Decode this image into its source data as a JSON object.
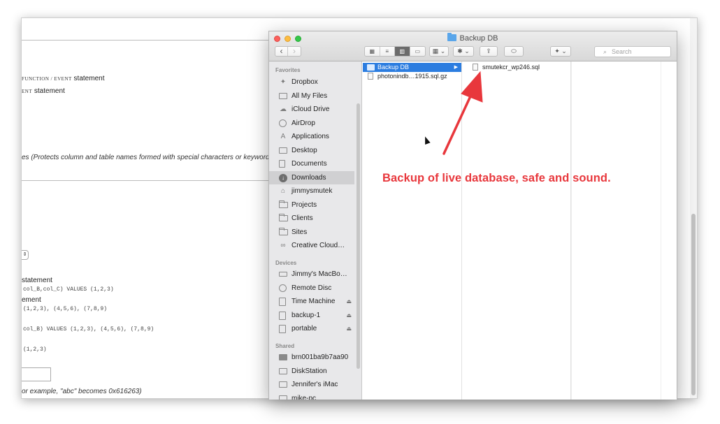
{
  "background_page": {
    "lines": [
      {
        "small_caps": "FUNCTION / EVENT",
        "text": " statement"
      },
      {
        "small_caps": "ENT",
        "text": " statement"
      }
    ],
    "protect_text": "es (Protects column and table names formed with special characters or keywords)",
    "select_glyph": "⇕",
    "statement_1": "statement",
    "code_1": "col_B,col_C) VALUES (1,2,3)",
    "statement_2": "ement",
    "code_2": "(1,2,3), (4,5,6), (7,8,9)",
    "code_3": "col_B) VALUES (1,2,3), (4,5,6), (7,8,9)",
    "code_4": "(1,2,3)",
    "example_text": "or example, \"abc\" becomes 0x616263)"
  },
  "finder": {
    "title": "Backup DB",
    "toolbar": {
      "back_label": "‹",
      "forward_label": "›",
      "view_icons": [
        "▦",
        "≡",
        "▥",
        "▭"
      ],
      "arrange_label": "▦ ⌄",
      "action_label": "✱ ⌄",
      "share_label": "⇪",
      "tag_label": "⬭",
      "dropbox_label": "✦ ⌄",
      "search_placeholder": "Search"
    },
    "sidebar": {
      "favorites_heading": "Favorites",
      "favorites": [
        {
          "label": "Dropbox",
          "icon": "dropbox-icon",
          "glyph": "✦"
        },
        {
          "label": "All My Files",
          "icon": "all-files-icon",
          "glyph": ""
        },
        {
          "label": "iCloud Drive",
          "icon": "cloud-icon",
          "glyph": "☁"
        },
        {
          "label": "AirDrop",
          "icon": "airdrop-icon",
          "glyph": ""
        },
        {
          "label": "Applications",
          "icon": "applications-icon",
          "glyph": "A"
        },
        {
          "label": "Desktop",
          "icon": "desktop-icon",
          "glyph": ""
        },
        {
          "label": "Documents",
          "icon": "documents-icon",
          "glyph": ""
        },
        {
          "label": "Downloads",
          "icon": "downloads-icon",
          "glyph": "↓"
        },
        {
          "label": "jimmysmutek",
          "icon": "home-icon",
          "glyph": "⌂"
        },
        {
          "label": "Projects",
          "icon": "folder-icon",
          "glyph": ""
        },
        {
          "label": "Clients",
          "icon": "folder-icon",
          "glyph": ""
        },
        {
          "label": "Sites",
          "icon": "folder-icon",
          "glyph": ""
        },
        {
          "label": "Creative Cloud…",
          "icon": "creative-cloud-icon",
          "glyph": "∞"
        }
      ],
      "devices_heading": "Devices",
      "devices": [
        {
          "label": "Jimmy's MacBo…",
          "icon": "laptop-icon",
          "eject": ""
        },
        {
          "label": "Remote Disc",
          "icon": "disc-icon",
          "eject": ""
        },
        {
          "label": "Time Machine",
          "icon": "drive-icon",
          "eject": "⏏"
        },
        {
          "label": "backup-1",
          "icon": "drive-icon",
          "eject": "⏏"
        },
        {
          "label": "portable",
          "icon": "drive-icon",
          "eject": "⏏"
        }
      ],
      "shared_heading": "Shared",
      "shared": [
        {
          "label": "brn001ba9b7aa90",
          "icon": "printer-icon"
        },
        {
          "label": "DiskStation",
          "icon": "display-icon"
        },
        {
          "label": "Jennifer's iMac",
          "icon": "display-icon"
        },
        {
          "label": "mike-pc",
          "icon": "display-icon"
        }
      ]
    },
    "column1": [
      {
        "label": "Backup DB",
        "type": "folder",
        "selected": true
      },
      {
        "label": "photonindb…1915.sql.gz",
        "type": "file",
        "selected": false
      }
    ],
    "column2": [
      {
        "label": "smutekcr_wp246.sql",
        "type": "file",
        "selected": false
      }
    ],
    "selected_sidebar_item": "Downloads"
  },
  "annotation": {
    "text": "Backup of live database, safe and sound.",
    "color": "#e8373c"
  }
}
